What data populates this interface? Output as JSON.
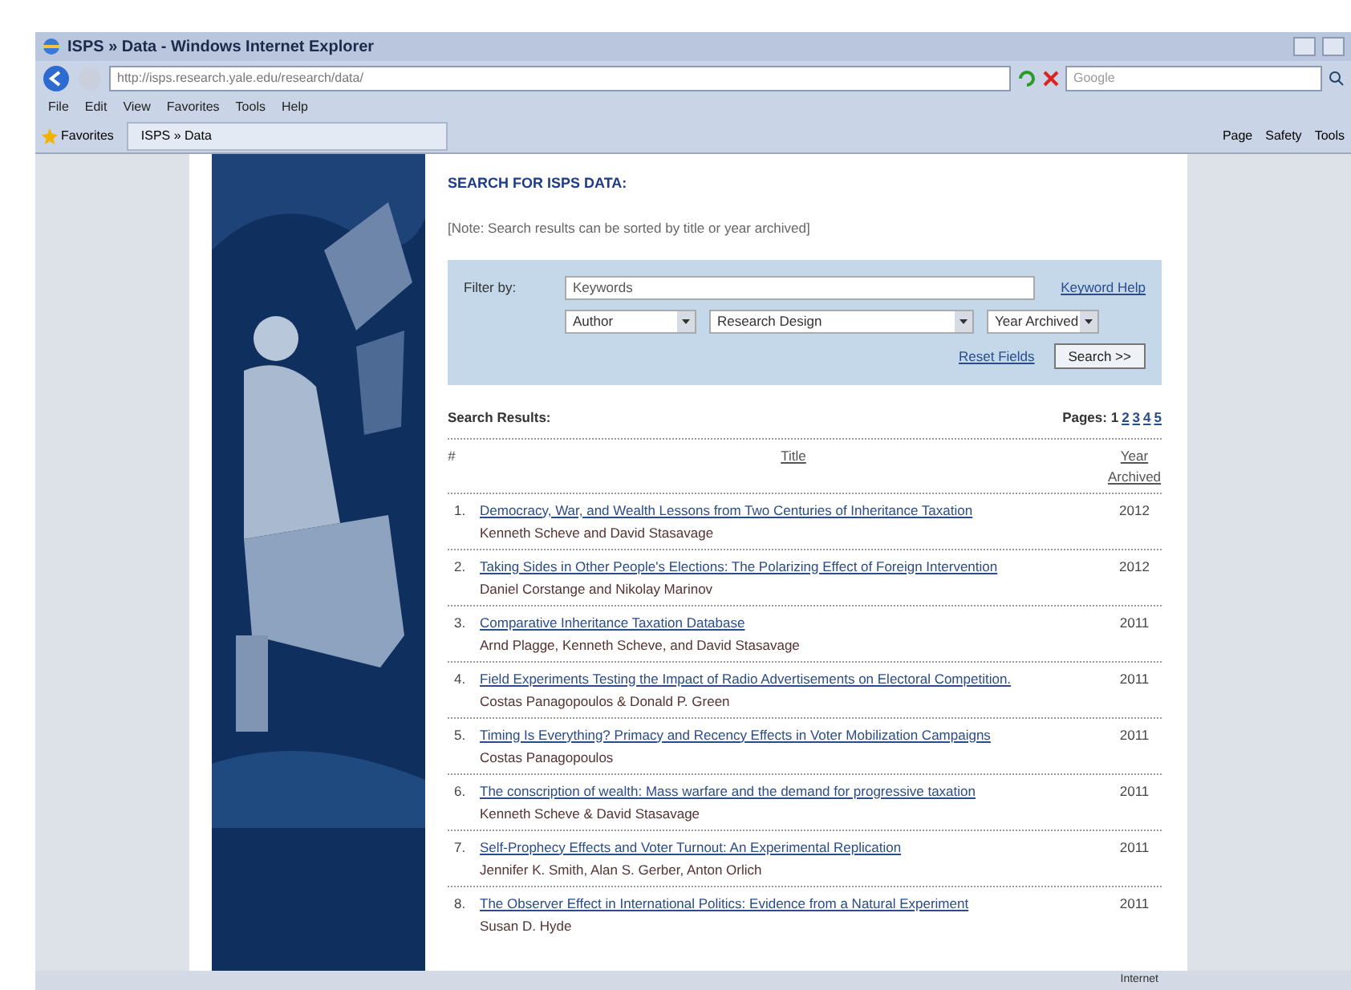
{
  "window": {
    "title": "ISPS » Data - Windows Internet Explorer"
  },
  "address_bar": {
    "url": "http://isps.research.yale.edu/research/data/",
    "search_placeholder": "Google"
  },
  "menu": [
    "File",
    "Edit",
    "View",
    "Favorites",
    "Tools",
    "Help"
  ],
  "favorites_bar": {
    "favorites": "Favorites",
    "tab": "ISPS » Data",
    "commands": [
      "Page",
      "Safety",
      "Tools"
    ]
  },
  "heading": "SEARCH FOR ISPS DATA:",
  "note": "[Note: Search results can be sorted by title or year archived]",
  "filter": {
    "label": "Filter by:",
    "keyword_placeholder": "Keywords",
    "keyword_help": "Keyword Help",
    "selects": [
      "Author",
      "Research Design",
      "Year Archived"
    ],
    "reset": "Reset Fields",
    "search": "Search >>"
  },
  "results": {
    "title": "Search Results:",
    "pages_label": "Pages: 1",
    "pages": [
      "2",
      "3",
      "4",
      "5"
    ],
    "columns": [
      "#",
      "Title",
      "Year Archived"
    ],
    "rows": [
      {
        "n": "1.",
        "title": "Democracy, War, and Wealth Lessons from Two Centuries of Inheritance Taxation",
        "authors": "Kenneth Scheve and David Stasavage",
        "year": "2012"
      },
      {
        "n": "2.",
        "title": "Taking Sides in Other People's Elections: The Polarizing Effect of Foreign Intervention",
        "authors": "Daniel Corstange and Nikolay Marinov",
        "year": "2012"
      },
      {
        "n": "3.",
        "title": "Comparative Inheritance Taxation Database",
        "authors": "Arnd Plagge, Kenneth Scheve, and David Stasavage",
        "year": "2011"
      },
      {
        "n": "4.",
        "title": "Field Experiments Testing the Impact of Radio Advertisements on Electoral Competition.",
        "authors": "Costas Panagopoulos & Donald P. Green",
        "year": "2011"
      },
      {
        "n": "5.",
        "title": "Timing Is Everything? Primacy and Recency Effects in Voter Mobilization Campaigns",
        "authors": "Costas Panagopoulos",
        "year": "2011"
      },
      {
        "n": "6.",
        "title": "The conscription of wealth: Mass warfare and the demand for progressive taxation",
        "authors": "Kenneth Scheve & David Stasavage",
        "year": "2011"
      },
      {
        "n": "7.",
        "title": "Self-Prophecy Effects and Voter Turnout: An Experimental Replication",
        "authors": "Jennifer K. Smith, Alan S. Gerber, Anton Orlich",
        "year": "2011"
      },
      {
        "n": "8.",
        "title": "The Observer Effect in International Politics: Evidence from a Natural Experiment",
        "authors": "Susan D. Hyde",
        "year": "2011"
      }
    ]
  },
  "status_bar": {
    "zone": "Internet"
  }
}
